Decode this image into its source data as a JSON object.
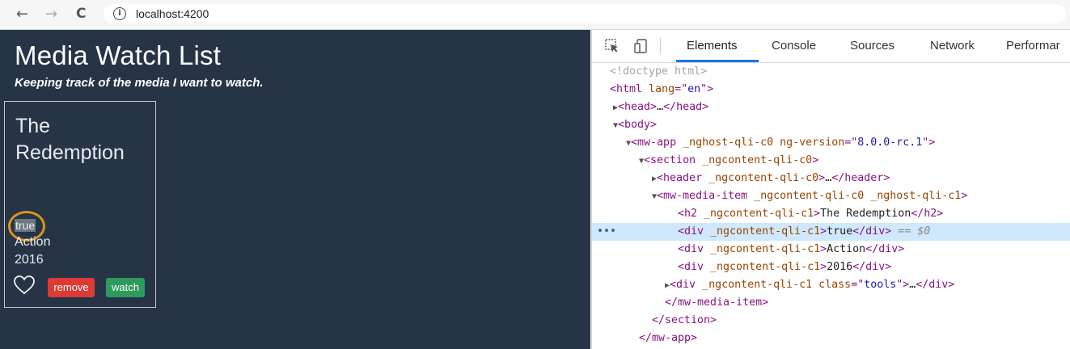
{
  "browser": {
    "back_glyph": "←",
    "forward_glyph": "→",
    "reload_glyph": "C",
    "info_glyph": "i",
    "url": "localhost:4200"
  },
  "app": {
    "title": "Media Watch List",
    "subtitle": "Keeping track of the media I want to watch.",
    "item": {
      "name": "The Redemption",
      "watched": "true",
      "genre": "Action",
      "year": "2016",
      "remove_label": "remove",
      "watch_label": "watch"
    }
  },
  "devtools": {
    "tabs": [
      "Elements",
      "Console",
      "Sources",
      "Network",
      "Performar"
    ],
    "active_tab": "Elements",
    "dom": {
      "doctype": "<!doctype html>",
      "html_lang": "en",
      "ng_version": "8.0.0-rc.1",
      "h2_text": "The Redemption",
      "div_watched": "true",
      "div_genre": "Action",
      "div_year": "2016",
      "tools_class": "tools",
      "selected_marker": "== $0"
    }
  },
  "colors": {
    "app_bg": "#273446",
    "remove": "#dc3a34",
    "watch": "#2e9a5e",
    "highlight_ring": "#d9951b",
    "selected_row": "#cfe8fc",
    "active_tab_underline": "#1a73e8"
  }
}
